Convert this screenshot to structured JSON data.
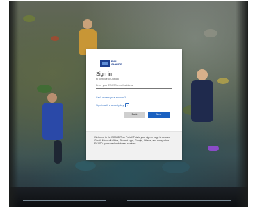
{
  "logo": {
    "text": "EAU CLAIRE"
  },
  "signin": {
    "title": "Sign in",
    "subtitle": "to continue to Outlook",
    "email_placeholder": "Enter your ECASD email address",
    "link_cant_access": "Can't access your account?",
    "link_security_key": "Sign in with a security key",
    "back_label": "Back",
    "next_label": "Next"
  },
  "footer": {
    "message": "Welcome to the ECASD Tech Portal! This is your sign-in page to access Gmail, Microsoft Office, Student Apps, Google, Athena, and many other ECASD-sponsored web-based services."
  },
  "colors": {
    "primary_button": "#1a61c1",
    "link": "#2a6bc2",
    "logo_blue": "#1d3f8f"
  }
}
